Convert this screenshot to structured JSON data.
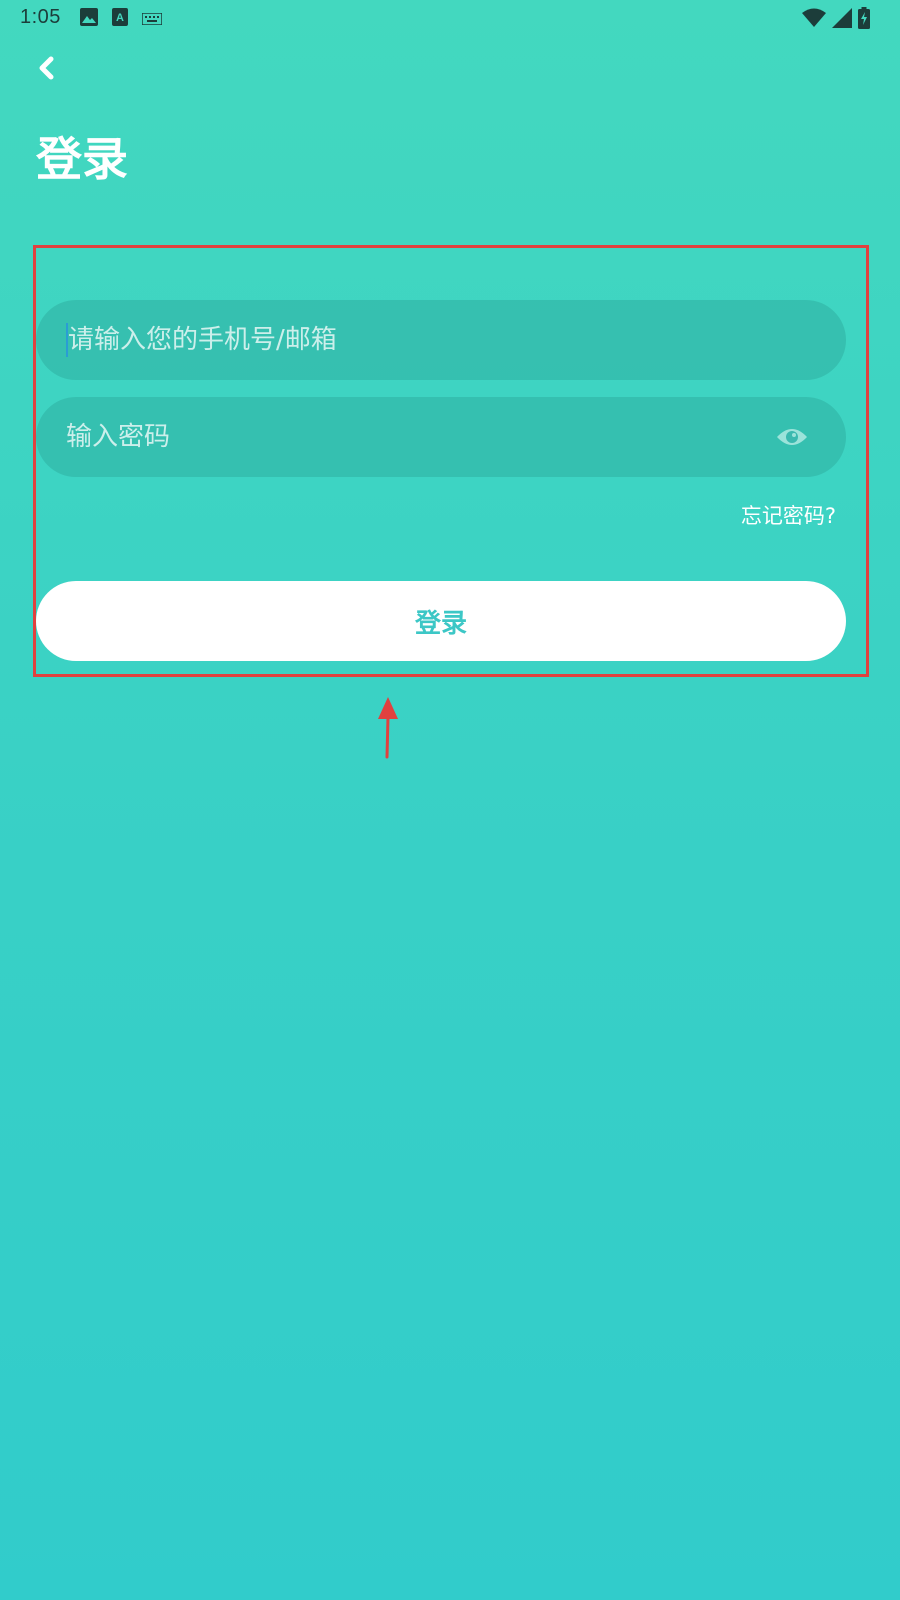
{
  "status_bar": {
    "time": "1:05",
    "left_icons": [
      "image-icon",
      "text-a-icon",
      "keyboard-icon"
    ],
    "right_icons": [
      "wifi-icon",
      "signal-icon",
      "battery-charging-icon"
    ]
  },
  "header": {
    "back_icon": "chevron-left-icon",
    "title": "登录"
  },
  "form": {
    "account_placeholder": "请输入您的手机号/邮箱",
    "account_value": "",
    "password_placeholder": "输入密码",
    "password_value": "",
    "password_toggle_icon": "eye-icon",
    "forgot_password": "忘记密码?",
    "login_label": "登录"
  },
  "colors": {
    "background_top": "#43d8bf",
    "background_bottom": "#31cccb",
    "button_text": "#3cc7c6",
    "annotation": "#e0413f"
  }
}
